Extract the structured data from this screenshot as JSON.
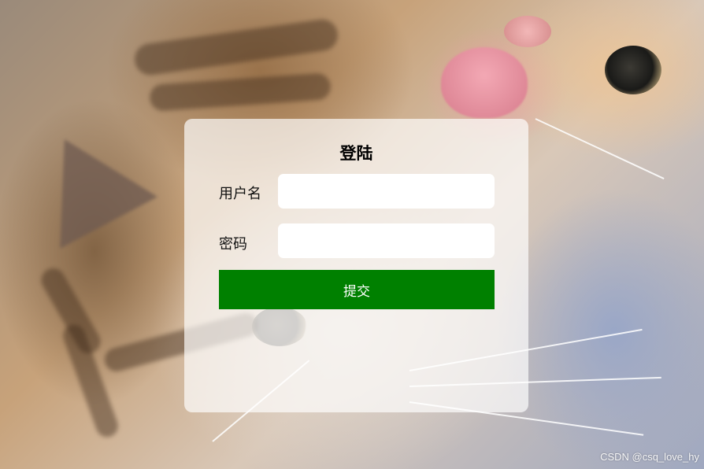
{
  "background": {
    "subject": "two kittens photo",
    "colors": {
      "fur_brown": "#c7a27a",
      "fur_light": "#d9c8b8",
      "backdrop_blue": "#9fa8c0",
      "tongue_pink": "#f3a8b4"
    }
  },
  "login": {
    "title": "登陆",
    "username_label": "用户名",
    "username_value": "",
    "password_label": "密码",
    "password_value": "",
    "submit_label": "提交"
  },
  "colors": {
    "submit_bg": "#008000",
    "panel_bg": "rgba(255,255,255,0.68)"
  },
  "watermark": "CSDN @csq_love_hy"
}
